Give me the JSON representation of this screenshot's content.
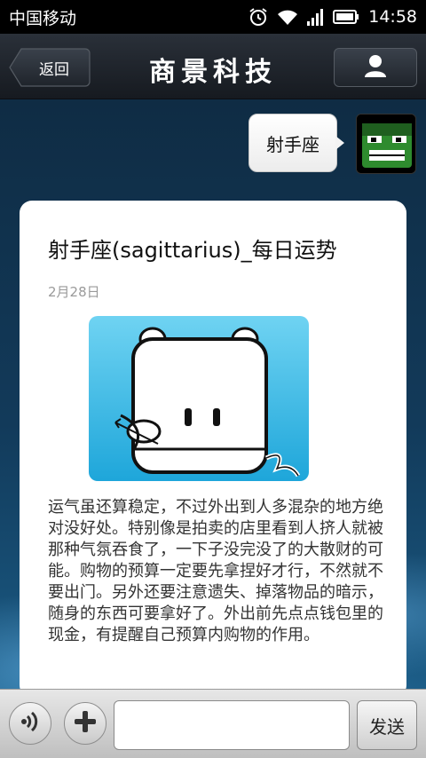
{
  "status_bar": {
    "carrier": "中国移动",
    "time": "14:58"
  },
  "header": {
    "back_label": "返回",
    "title": "商景科技"
  },
  "chat": {
    "outgoing_message": "射手座",
    "card": {
      "title": "射手座(sagittarius)_每日运势",
      "date": "2月28日",
      "body": "运气虽还算稳定，不过外出到人多混杂的地方绝对没好处。特别像是拍卖的店里看到人挤人就被那种气氛吞食了，一下子没完没了的大散财的可能。购物的预算一定要先拿捏好才行，不然就不要出门。另外还要注意遗失、掉落物品的暗示，随身的东西可要拿好了。外出前先点点钱包里的现金，有提醒自己预算内购物的作用。"
    }
  },
  "input_bar": {
    "message_value": "",
    "send_label": "发送"
  },
  "colors": {
    "accent": "#1a5b85",
    "image_bg": "#4fc3ec"
  }
}
